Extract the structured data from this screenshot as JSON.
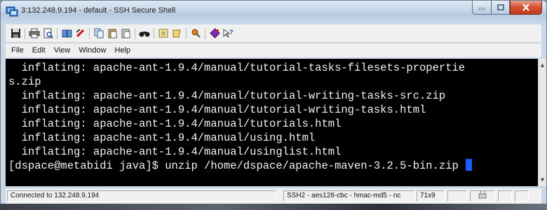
{
  "window": {
    "title": "3:132.248.9.194 - default - SSH Secure Shell"
  },
  "toolbar": {
    "icons": [
      "save-icon",
      "print-icon",
      "print-preview-icon",
      "quick-connect-icon",
      "disconnect-icon",
      "copy-icon",
      "paste-icon",
      "paste-select-icon",
      "find-icon",
      "settings-icon",
      "profiles-icon",
      "file-transfer-icon",
      "new-terminal-icon",
      "help-icon"
    ]
  },
  "menu": {
    "items": [
      "File",
      "Edit",
      "View",
      "Window",
      "Help"
    ]
  },
  "terminal": {
    "lines": [
      "  inflating: apache-ant-1.9.4/manual/tutorial-tasks-filesets-propertie",
      "s.zip",
      "  inflating: apache-ant-1.9.4/manual/tutorial-writing-tasks-src.zip",
      "  inflating: apache-ant-1.9.4/manual/tutorial-writing-tasks.html",
      "  inflating: apache-ant-1.9.4/manual/tutorials.html",
      "  inflating: apache-ant-1.9.4/manual/using.html",
      "  inflating: apache-ant-1.9.4/manual/usinglist.html",
      "[dspace@metabidi java]$ unzip /home/dspace/apache-maven-3.2.5-bin.zip "
    ],
    "cursor_color": "#1e5bff"
  },
  "status": {
    "connection": "Connected to 132.248.9.194",
    "cipher": "SSH2 - aes128-cbc - hmac-md5 - nc",
    "size": "71x9"
  },
  "colors": {
    "terminal_bg": "#000000",
    "terminal_fg": "#f2f2f2",
    "close_button": "#c23a1b"
  }
}
